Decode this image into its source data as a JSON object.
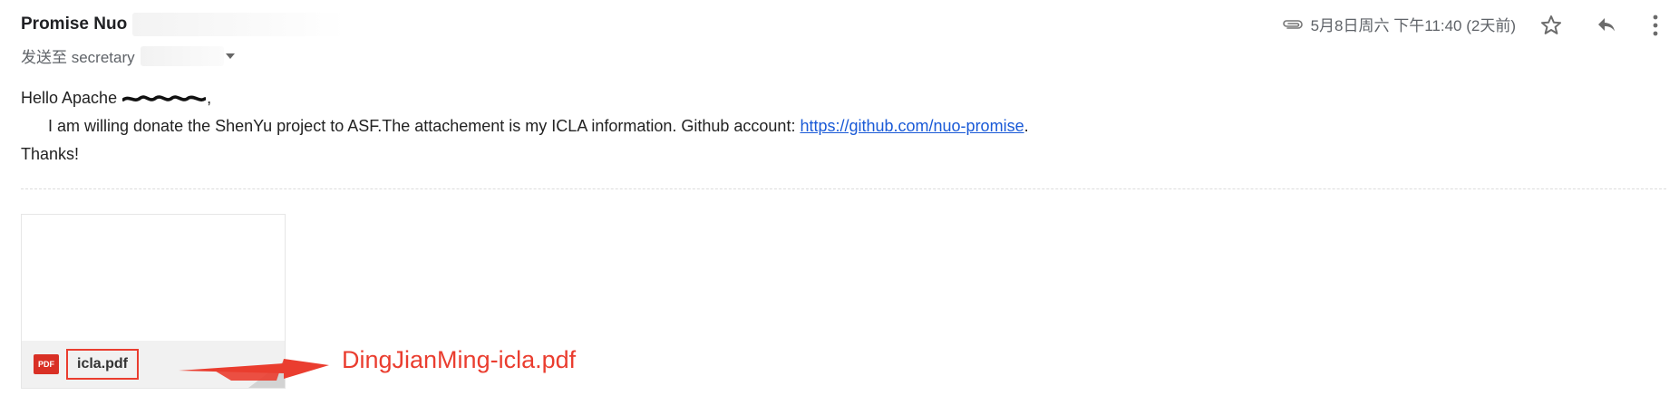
{
  "email": {
    "sender_name": "Promise Nuo",
    "to_label": "发送至 secretary",
    "date": "5月8日周六 下午11:40 (2天前)",
    "greeting": "Hello Apache",
    "greeting_suffix": ",",
    "line_prefix": "I am willing donate the ShenYu project to ASF.The attachement is my ICLA information. Github account: ",
    "github_link": "https://github.com/nuo-promise",
    "line_suffix": ".",
    "closing": "Thanks!"
  },
  "attachment": {
    "badge": "PDF",
    "filename": "icla.pdf"
  },
  "annotation": {
    "text": "DingJianMing-icla.pdf",
    "color": "#ea3d2f"
  },
  "icons": {
    "attachment": "paperclip-icon",
    "star": "star-icon",
    "reply": "reply-icon",
    "more": "more-vertical-icon",
    "pdf": "pdf-icon",
    "arrow": "arrow-right-icon"
  },
  "colors": {
    "link": "#1a5ad7",
    "annotation": "#ea3d2f",
    "pdf_badge": "#d93025"
  }
}
